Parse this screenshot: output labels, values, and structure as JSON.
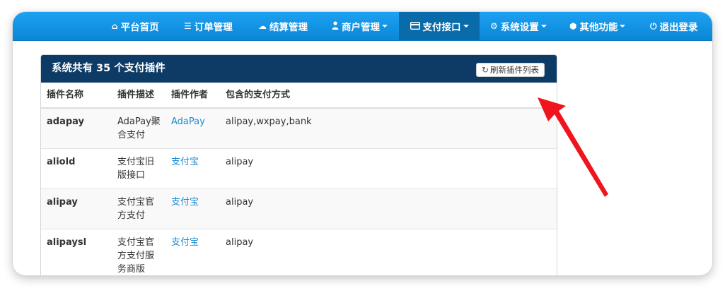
{
  "nav": {
    "items": [
      {
        "icon": "home-icon",
        "glyph": "⌂",
        "label": "平台首页"
      },
      {
        "icon": "list-icon",
        "glyph": "☰",
        "label": "订单管理"
      },
      {
        "icon": "cloud-icon",
        "glyph": "☁",
        "label": "结算管理"
      },
      {
        "icon": "user-icon",
        "glyph": "👤",
        "label": "商户管理"
      },
      {
        "icon": "credit-card-icon",
        "glyph": "▭",
        "label": "支付接口"
      },
      {
        "icon": "gear-icon",
        "glyph": "⚙",
        "label": "系统设置"
      },
      {
        "icon": "cube-icon",
        "glyph": "⬢",
        "label": "其他功能"
      },
      {
        "icon": "power-icon",
        "glyph": "⏻",
        "label": "退出登录"
      }
    ],
    "active": "支付接口"
  },
  "panel": {
    "title": "系统共有 35 个支付插件",
    "refresh_icon": "refresh-icon",
    "refresh_label": "刷新插件列表"
  },
  "table": {
    "headers": [
      "插件名称",
      "插件描述",
      "插件作者",
      "包含的支付方式"
    ],
    "rows": [
      {
        "name": "adapay",
        "desc": "AdaPay聚合支付",
        "author": "AdaPay",
        "methods": "alipay,wxpay,bank"
      },
      {
        "name": "aliold",
        "desc": "支付宝旧版接口",
        "author": "支付宝",
        "methods": "alipay"
      },
      {
        "name": "alipay",
        "desc": "支付宝官方支付",
        "author": "支付宝",
        "methods": "alipay"
      },
      {
        "name": "alipaysl",
        "desc": "支付宝官方支付服务商版",
        "author": "支付宝",
        "methods": "alipay"
      }
    ]
  },
  "colors": {
    "navbar": "#1592e6",
    "panel_header": "#0d3b66",
    "link": "#1b8bd1",
    "arrow": "#f0141e"
  }
}
